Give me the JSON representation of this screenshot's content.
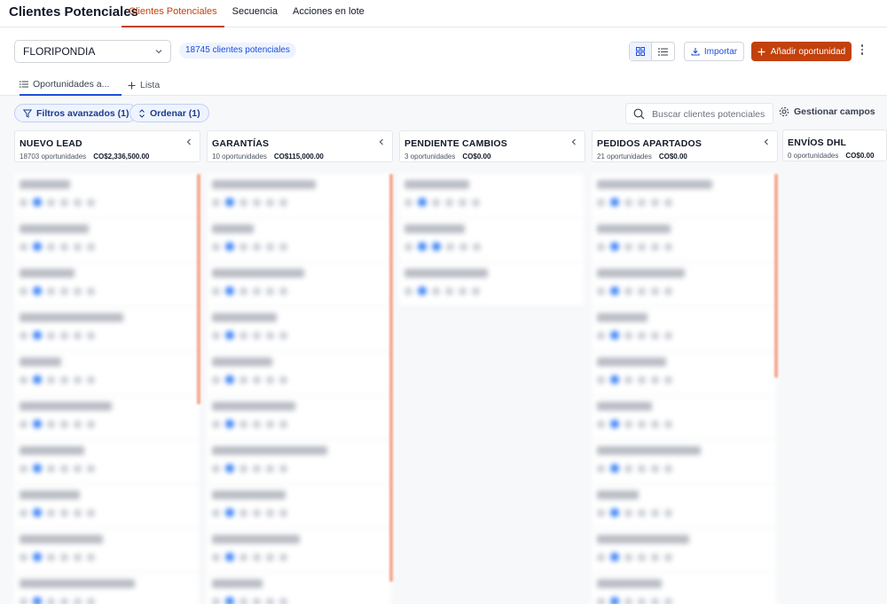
{
  "topbar": {
    "title": "Clientes Potenciales",
    "tabs": [
      {
        "label": "Clientes Potenciales",
        "active": true
      },
      {
        "label": "Secuencia",
        "active": false
      },
      {
        "label": "Acciones en lote",
        "active": false
      }
    ]
  },
  "header": {
    "pipeline": "FLORIPONDIA",
    "count_badge": "18745 clientes potenciales",
    "import_label": "Importar",
    "add_label": "Añadir oportunidad",
    "subtabs": [
      {
        "label": "Oportunidades a..."
      },
      {
        "label": "Lista"
      }
    ]
  },
  "filters": {
    "advanced": "Filtros avanzados (1)",
    "sort": "Ordenar (1)",
    "search_placeholder": "Buscar clientes potenciales",
    "manage_fields": "Gestionar campos"
  },
  "columns": [
    {
      "name": "NUEVO LEAD",
      "count": "18703 oportunidades",
      "amount": "CO$2,336,500.00"
    },
    {
      "name": "GARANTÍAS",
      "count": "10 oportunidades",
      "amount": "CO$115,000.00"
    },
    {
      "name": "PENDIENTE CAMBIOS",
      "count": "3 oportunidades",
      "amount": "CO$0.00"
    },
    {
      "name": "PEDIDOS APARTADOS",
      "count": "21 oportunidades",
      "amount": "CO$0.00"
    },
    {
      "name": "ENVÍOS DHL",
      "count": "0 oportunidades",
      "amount": "CO$0.00"
    }
  ],
  "colors": {
    "accent": "#c2410c",
    "link": "#1d4ed8"
  }
}
